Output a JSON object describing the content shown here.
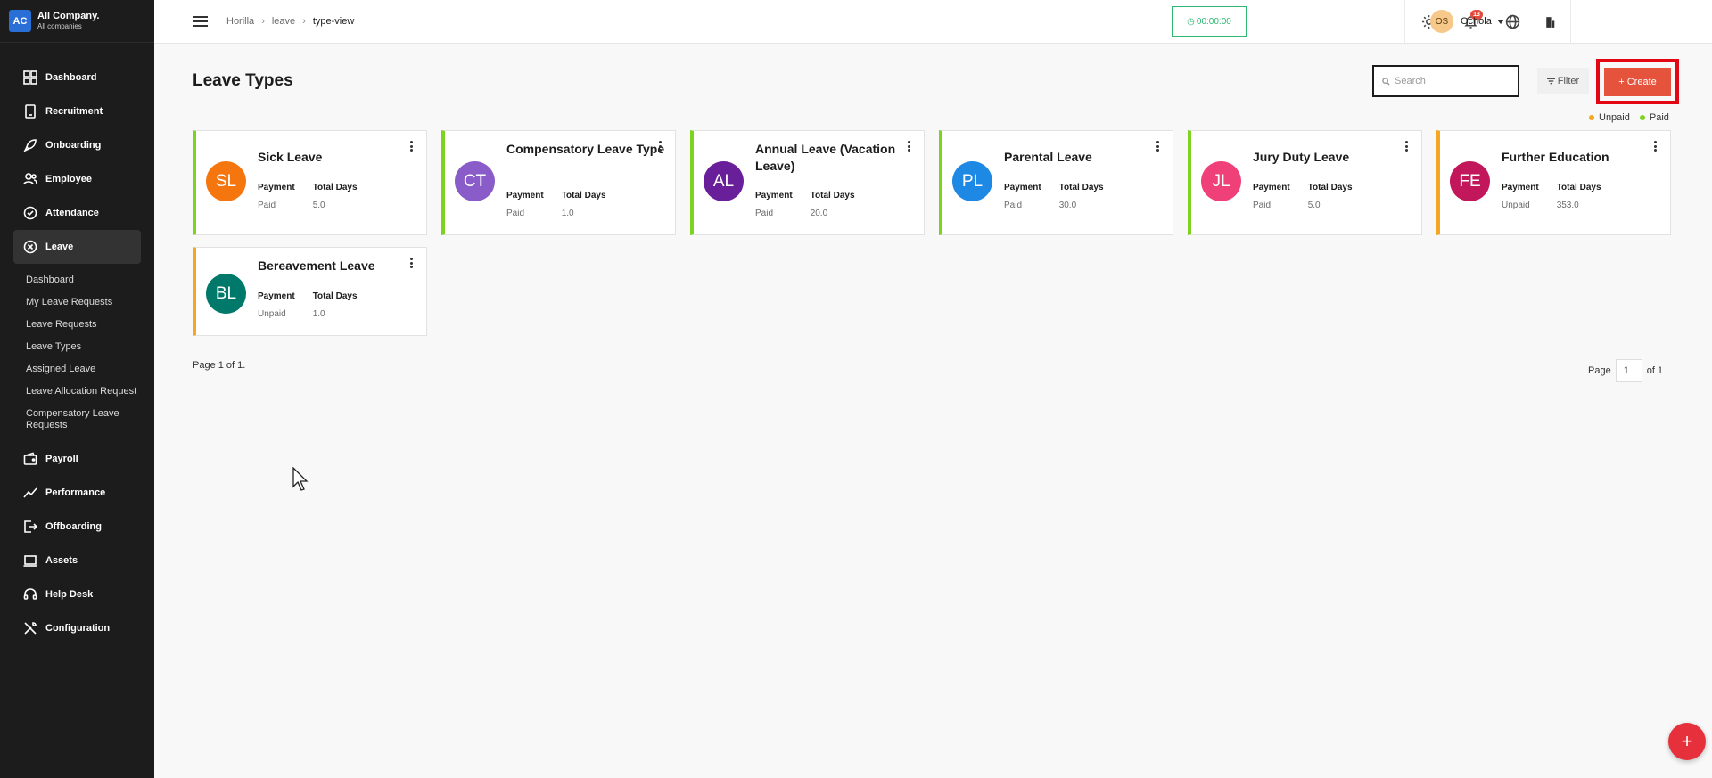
{
  "brand": {
    "logo": "AC",
    "name": "All Company.",
    "sub": "All companies"
  },
  "sidebar": {
    "items": [
      {
        "label": "Dashboard",
        "icon": "dashboard-icon"
      },
      {
        "label": "Recruitment",
        "icon": "recruitment-icon"
      },
      {
        "label": "Onboarding",
        "icon": "rocket-icon"
      },
      {
        "label": "Employee",
        "icon": "people-icon"
      },
      {
        "label": "Attendance",
        "icon": "check-circle-icon"
      },
      {
        "label": "Leave",
        "icon": "leave-icon",
        "active": true
      },
      {
        "label": "Payroll",
        "icon": "wallet-icon"
      },
      {
        "label": "Performance",
        "icon": "trend-icon"
      },
      {
        "label": "Offboarding",
        "icon": "exit-icon"
      },
      {
        "label": "Assets",
        "icon": "laptop-icon"
      },
      {
        "label": "Help Desk",
        "icon": "headset-icon"
      },
      {
        "label": "Configuration",
        "icon": "tools-icon"
      }
    ],
    "leave_sub": [
      "Dashboard",
      "My Leave Requests",
      "Leave Requests",
      "Leave Types",
      "Assigned Leave",
      "Leave Allocation Request",
      "Compensatory Leave Requests"
    ]
  },
  "header": {
    "breadcrumb": [
      "Horilla",
      "leave",
      "type-view"
    ],
    "timer": "00:00:00",
    "notifications": "13",
    "user": {
      "initials": "OS",
      "name": "Ochola"
    }
  },
  "main": {
    "title": "Leave Types",
    "search_placeholder": "Search",
    "filter_label": "Filter",
    "create_label": "+ Create",
    "legend": [
      {
        "label": "Unpaid",
        "color": "#f5a623"
      },
      {
        "label": "Paid",
        "color": "#7ed321"
      }
    ],
    "payment_label": "Payment",
    "total_days_label": "Total Days",
    "cards": [
      {
        "initials": "SL",
        "title": "Sick Leave",
        "payment": "Paid",
        "days": "5.0",
        "color": "#f5750f",
        "paid": true
      },
      {
        "initials": "CT",
        "title": "Compensatory Leave Type",
        "payment": "Paid",
        "days": "1.0",
        "color": "#8a5cc9",
        "paid": true
      },
      {
        "initials": "AL",
        "title": "Annual Leave (Vacation Leave)",
        "payment": "Paid",
        "days": "20.0",
        "color": "#6a1f9a",
        "paid": true
      },
      {
        "initials": "PL",
        "title": "Parental Leave",
        "payment": "Paid",
        "days": "30.0",
        "color": "#1e88e5",
        "paid": true
      },
      {
        "initials": "JL",
        "title": "Jury Duty Leave",
        "payment": "Paid",
        "days": "5.0",
        "color": "#f0407a",
        "paid": true
      },
      {
        "initials": "FE",
        "title": "Further Education",
        "payment": "Unpaid",
        "days": "353.0",
        "color": "#c2185b",
        "paid": false
      },
      {
        "initials": "BL",
        "title": "Bereavement Leave",
        "payment": "Unpaid",
        "days": "1.0",
        "color": "#00796b",
        "paid": false
      }
    ],
    "page_info": "Page 1 of 1.",
    "pager": {
      "label": "Page",
      "current": "1",
      "total_label": "of 1"
    }
  },
  "fab_label": "+"
}
